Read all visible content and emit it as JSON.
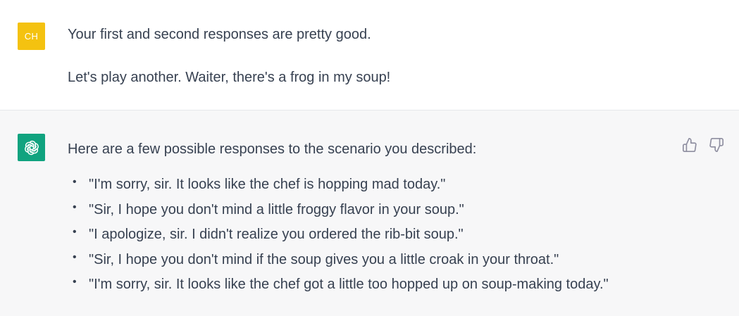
{
  "user_message": {
    "avatar_initials": "CH",
    "avatar_color": "#f4c210",
    "paragraphs": [
      "Your first and second responses are pretty good.",
      "Let's play another. Waiter, there's a frog in my soup!"
    ]
  },
  "assistant_message": {
    "avatar_color": "#10a37f",
    "avatar_icon": "openai-logo-icon",
    "intro": "Here are a few possible responses to the scenario you described:",
    "items": [
      "\"I'm sorry, sir. It looks like the chef is hopping mad today.\"",
      "\"Sir, I hope you don't mind a little froggy flavor in your soup.\"",
      "\"I apologize, sir. I didn't realize you ordered the rib-bit soup.\"",
      "\"Sir, I hope you don't mind if the soup gives you a little croak in your throat.\"",
      "\"I'm sorry, sir. It looks like the chef got a little too hopped up on soup-making today.\""
    ],
    "feedback": {
      "thumbs_up_icon": "thumbs-up-icon",
      "thumbs_down_icon": "thumbs-down-icon"
    }
  }
}
